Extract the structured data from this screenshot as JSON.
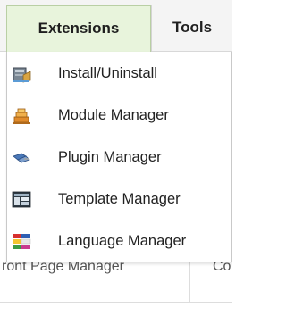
{
  "menubar": {
    "tabs": [
      {
        "label": "Extensions",
        "active": true
      },
      {
        "label": "Tools",
        "active": false
      }
    ]
  },
  "dropdown": {
    "items": [
      {
        "label": "Install/Uninstall",
        "icon": "install-icon"
      },
      {
        "label": "Module Manager",
        "icon": "module-icon"
      },
      {
        "label": "Plugin Manager",
        "icon": "plugin-icon"
      },
      {
        "label": "Template Manager",
        "icon": "template-icon"
      },
      {
        "label": "Language Manager",
        "icon": "language-icon"
      }
    ]
  },
  "background": {
    "partial_left_label": "ront Page Manager",
    "partial_right_label": "Co"
  },
  "colors": {
    "active_tab_bg": "#e8f4dc",
    "menubar_bg": "#f4f4f4",
    "text": "#222222"
  }
}
